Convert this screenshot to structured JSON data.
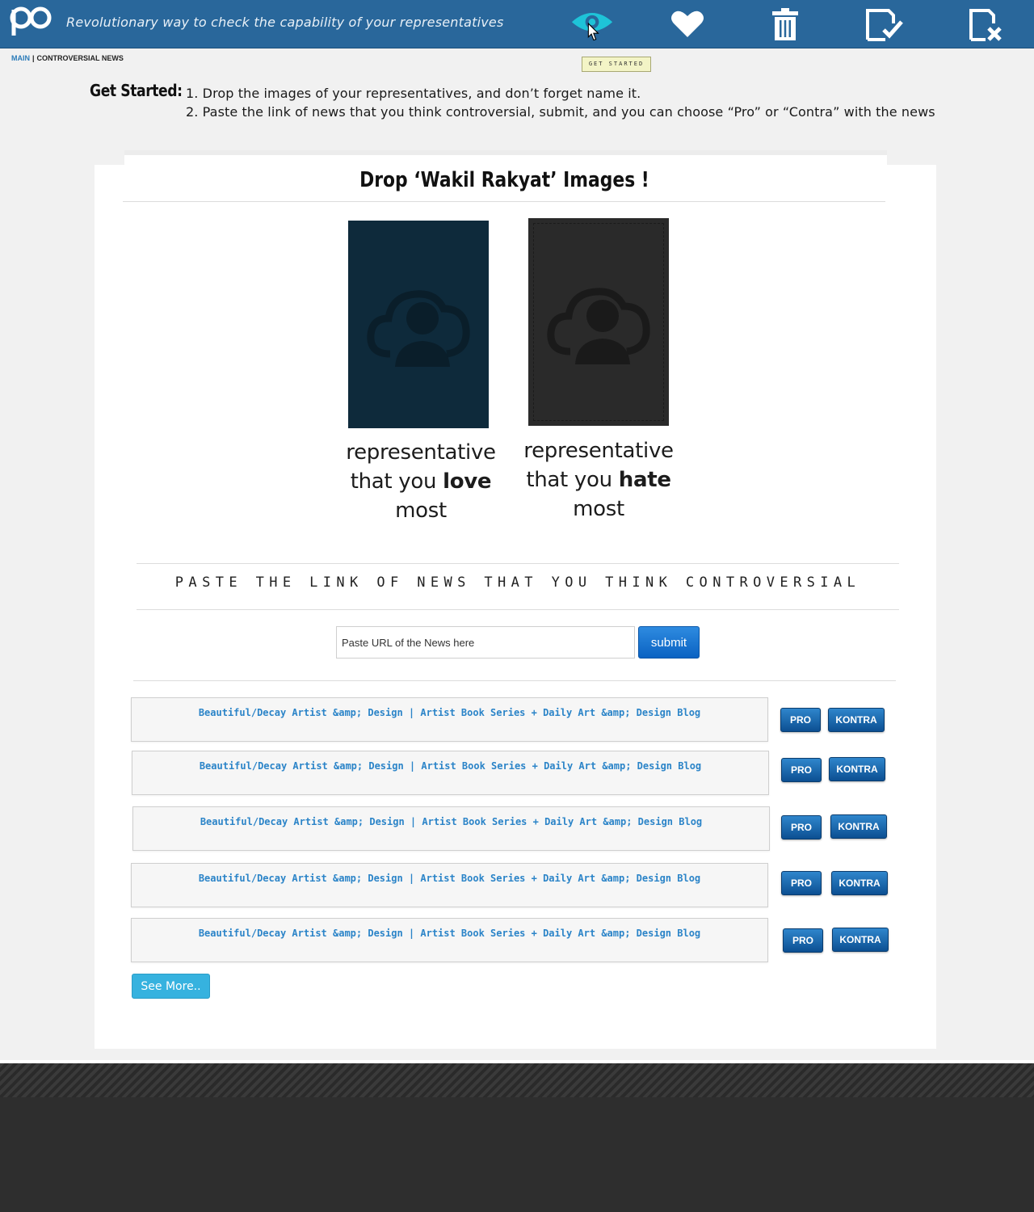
{
  "header": {
    "logo_text": "po",
    "tagline": "Revolutionary way to check the capability of your representatives",
    "nav_icons": [
      "eye-icon",
      "heart-icon",
      "trash-icon",
      "document-check-icon",
      "document-cross-icon"
    ],
    "tooltip": "GET STARTED"
  },
  "breadcrumb": {
    "main": "MAIN",
    "separator": "|",
    "current": "CONTROVERSIAL NEWS"
  },
  "get_started": {
    "title": "Get Started:",
    "step1": "1. Drop the images of your representatives, and don’t forget name it.",
    "step2": "2. Paste the link of news that you think controversial, submit, and you can choose “Pro” or “Contra” with the news"
  },
  "drop_section": {
    "title": "Drop ‘Wakil Rakyat’ Images !",
    "love": {
      "line1": "representative",
      "line2_pre": "that you ",
      "line2_bold": "love",
      "line3": "most"
    },
    "hate": {
      "line1": "representative",
      "line2_pre": "that you ",
      "line2_bold": "hate",
      "line3": "most"
    }
  },
  "paste_section": {
    "title": "PASTE THE LINK OF NEWS THAT YOU THINK CONTROVERSIAL",
    "input_placeholder": "Paste URL of the News here",
    "submit_label": "submit"
  },
  "news": [
    {
      "title": "Beautiful/Decay Artist &amp; Design | Artist Book Series + Daily Art &amp; Design Blog",
      "pro": "PRO",
      "kontra": "KONTRA"
    },
    {
      "title": "Beautiful/Decay Artist &amp; Design | Artist Book Series + Daily Art &amp; Design Blog",
      "pro": "PRO",
      "kontra": "KONTRA"
    },
    {
      "title": "Beautiful/Decay Artist &amp; Design | Artist Book Series + Daily Art &amp; Design Blog",
      "pro": "PRO",
      "kontra": "KONTRA"
    },
    {
      "title": "Beautiful/Decay Artist &amp; Design | Artist Book Series + Daily Art &amp; Design Blog",
      "pro": "PRO",
      "kontra": "KONTRA"
    },
    {
      "title": "Beautiful/Decay Artist &amp; Design | Artist Book Series + Daily Art &amp; Design Blog",
      "pro": "PRO",
      "kontra": "KONTRA"
    }
  ],
  "see_more_label": "See More..",
  "colors": {
    "header_bg": "#29679b",
    "accent_blue": "#2b84c8",
    "eye_active": "#1ec3d8",
    "love_panel": "#0e2a3b",
    "hate_panel": "#2a2a2a",
    "footer_bg": "#2e2e2e"
  }
}
